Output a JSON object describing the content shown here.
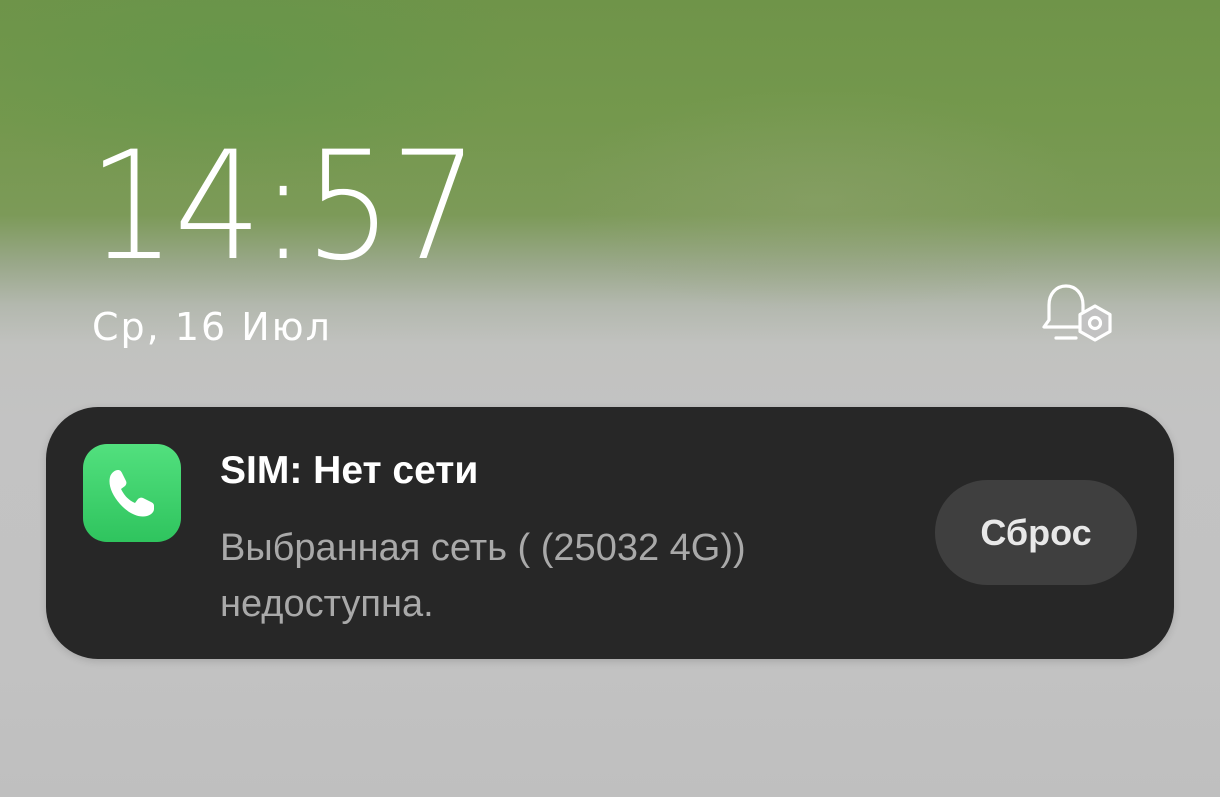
{
  "lockscreen": {
    "time": "14:57",
    "date": "Ср, 16 Июл",
    "bell_icon": "bell-settings-icon"
  },
  "notification": {
    "app_icon": "phone-icon",
    "app_icon_color": "#3fd26c",
    "title": "SIM: Нет сети",
    "body_lines": [
      "Выбранная сеть ( (25032 4G))",
      "недоступна."
    ],
    "action_label": "Сброс",
    "background": "#272727"
  }
}
